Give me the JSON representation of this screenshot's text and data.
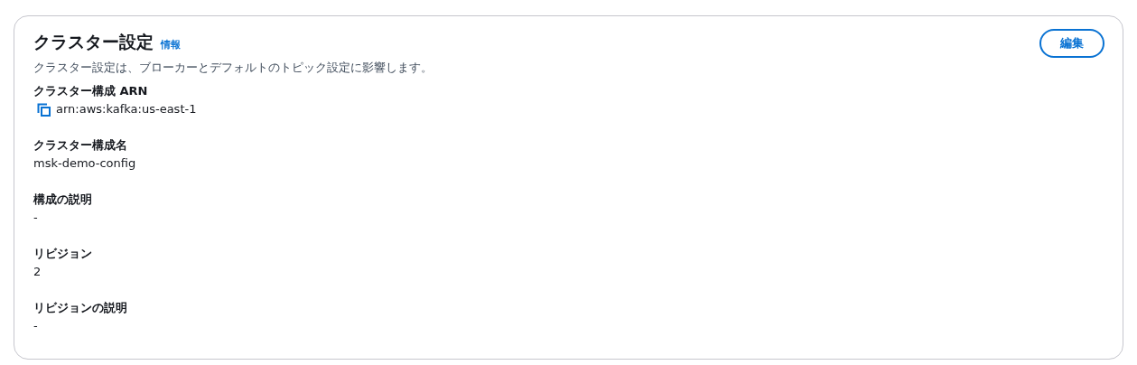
{
  "panel": {
    "title": "クラスター設定",
    "info_link": "情報",
    "description": "クラスター設定は、ブローカーとデフォルトのトピック設定に影響します。",
    "edit_button": "編集"
  },
  "fields": [
    {
      "label": "クラスター構成 ARN",
      "value": "arn:aws:kafka:us-east-1",
      "kind": "copyable"
    },
    {
      "label": "クラスター構成名",
      "value": "msk-demo-config",
      "kind": "plain"
    },
    {
      "label": "構成の説明",
      "value": "-",
      "kind": "plain"
    },
    {
      "label": "リビジョン",
      "value": "2",
      "kind": "plain"
    },
    {
      "label": "リビジョンの説明",
      "value": "-",
      "kind": "plain"
    }
  ]
}
